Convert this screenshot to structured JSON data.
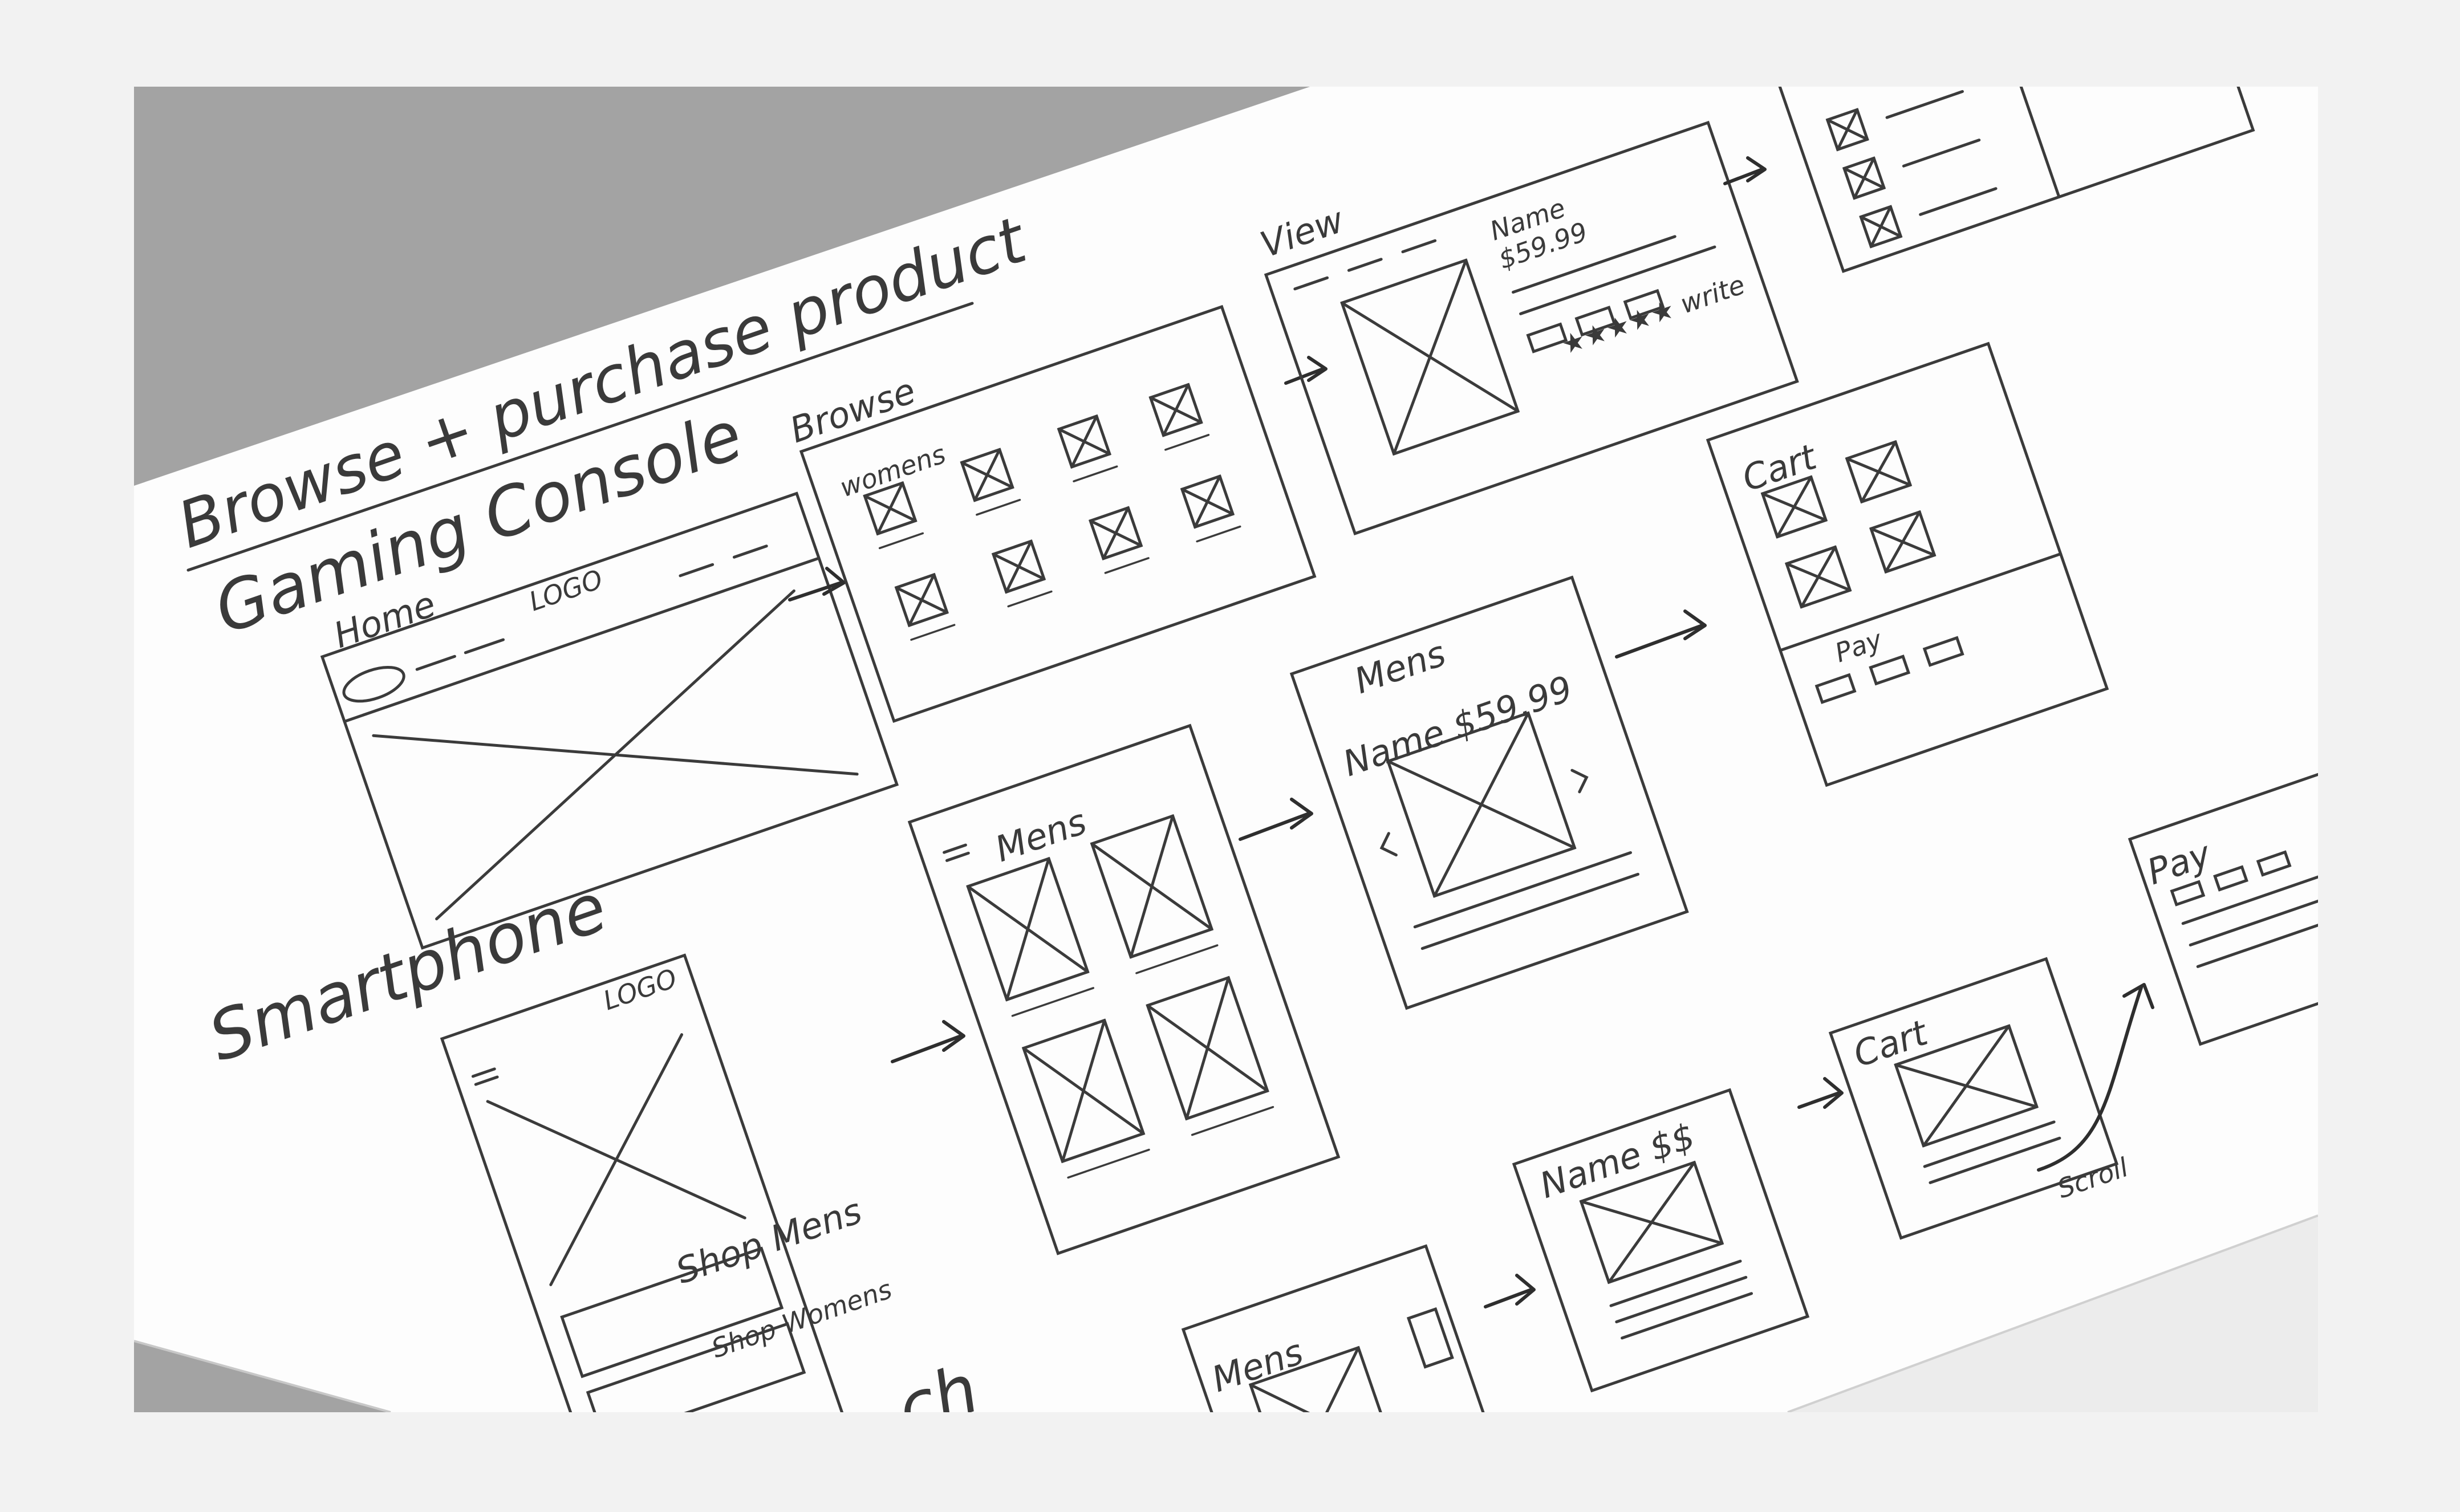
{
  "title": "Browse + purchase product",
  "sections": {
    "gaming_console": "Gaming Console",
    "smartphone": "Smartphone",
    "watch_partial": "...ch"
  },
  "labels": {
    "home": "Home",
    "logo_1": "LOGO",
    "browse": "Browse",
    "womens": "womens",
    "view": "View",
    "view_name": "Name",
    "view_price": "$59.99",
    "view_rating": "★★★★★ write",
    "mens_1": "Mens",
    "mens_name_price": "Name $59.99",
    "cart_1": "Cart",
    "pay_1": "Pay",
    "logo_2": "LOGO",
    "shop_mens": "Shop Mens",
    "shop_womens": "Shop Womens",
    "mens_2": "Mens",
    "mens_3": "Mens",
    "name_price": "Name $$",
    "cart_2": "Cart",
    "pay_2": "Pay",
    "scroll": "Scroll"
  },
  "colors": {
    "paper": "#fdfdfd",
    "table": "#a3a3a3",
    "pencil": "#3b3b3b",
    "matte": "#f2f2f2"
  }
}
